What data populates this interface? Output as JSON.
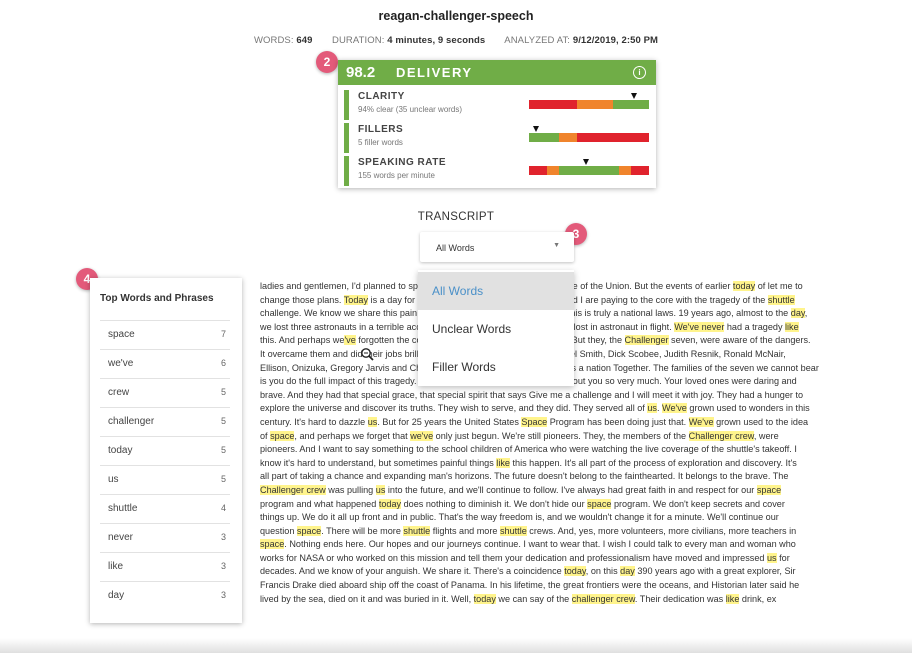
{
  "title": "reagan-challenger-speech",
  "meta": {
    "words_label": "WORDS:",
    "words_value": "649",
    "duration_label": "DURATION:",
    "duration_value": "4 minutes, 9 seconds",
    "analyzed_label": "ANALYZED AT:",
    "analyzed_value": "9/12/2019, 2:50 PM"
  },
  "badges": [
    "2",
    "3",
    "4"
  ],
  "delivery": {
    "score": "98.2",
    "title": "DELIVERY",
    "info_icon": "info-icon",
    "header_color": "#70ad47",
    "metrics": [
      {
        "name": "CLARITY",
        "sub": "94% clear (35 unclear words)",
        "marker_pos": 0.88,
        "segments": [
          {
            "color": "#e0232d",
            "frac": 0.4
          },
          {
            "color": "#f0842c",
            "frac": 0.3
          },
          {
            "color": "#70ad47",
            "frac": 0.3
          }
        ]
      },
      {
        "name": "FILLERS",
        "sub": "5 filler words",
        "marker_pos": 0.06,
        "segments": [
          {
            "color": "#70ad47",
            "frac": 0.25
          },
          {
            "color": "#f0842c",
            "frac": 0.15
          },
          {
            "color": "#e0232d",
            "frac": 0.6
          }
        ]
      },
      {
        "name": "SPEAKING RATE",
        "sub": "155 words per minute",
        "marker_pos": 0.48,
        "segments": [
          {
            "color": "#e0232d",
            "frac": 0.15
          },
          {
            "color": "#f0842c",
            "frac": 0.1
          },
          {
            "color": "#70ad47",
            "frac": 0.5
          },
          {
            "color": "#f0842c",
            "frac": 0.1
          },
          {
            "color": "#e0232d",
            "frac": 0.15
          }
        ]
      }
    ]
  },
  "transcript_label": "TRANSCRIPT",
  "select": {
    "value": "All Words",
    "caret": "▼"
  },
  "dropdown": {
    "options": [
      "All Words",
      "Unclear Words",
      "Filler Words"
    ],
    "active": 0
  },
  "top_words": {
    "title": "Top Words and Phrases",
    "items": [
      {
        "word": "space",
        "count": "7"
      },
      {
        "word": "we've",
        "count": "6"
      },
      {
        "word": "crew",
        "count": "5"
      },
      {
        "word": "challenger",
        "count": "5"
      },
      {
        "word": "today",
        "count": "5"
      },
      {
        "word": "us",
        "count": "5"
      },
      {
        "word": "shuttle",
        "count": "4"
      },
      {
        "word": "never",
        "count": "3"
      },
      {
        "word": "like",
        "count": "3"
      },
      {
        "word": "day",
        "count": "3"
      }
    ]
  },
  "highlight_color": "#fff48c",
  "transcript_lines": [
    [
      [
        "ladies and gentlemen, I'd planned ",
        0
      ],
      [
        "to speak to you tonight to report on the State of the Union. But the events of earlier ",
        2
      ],
      [
        "today",
        1
      ],
      [
        " of let me to",
        0
      ]
    ],
    [
      [
        "change those plans. ",
        0
      ],
      [
        "Today",
        1
      ],
      [
        " is a day for mourning and remembering. Nancy and I are paying to the core with the tragedy of the ",
        0
      ],
      [
        "shuttle",
        1
      ]
    ],
    [
      [
        "challenge. We know we share this pain with all of the people of our country. This is truly a national laws. 19 years ago, almost to the ",
        0
      ],
      [
        "day",
        1
      ],
      [
        ",",
        0
      ]
    ],
    [
      [
        "we lost three astronauts in a terrible accident on the ground. But we ",
        0
      ],
      [
        "'ve never",
        1
      ],
      [
        " lost in astronaut in flight. ",
        0
      ],
      [
        "We've never",
        1
      ],
      [
        " had a tragedy ",
        0
      ],
      [
        "like",
        1
      ]
    ],
    [
      [
        "this. And perhaps we",
        0
      ],
      [
        "'ve",
        1
      ],
      [
        " forgotten the courage it took for the crew of the shot. But they, the ",
        0
      ],
      [
        "Challenger",
        1
      ],
      [
        " seven, were aware of the dangers.",
        0
      ]
    ],
    [
      [
        "It overcame them and did their jobs brilliantly. We mourn seven heroes Michael Smith, Dick Scobee, Judith Resnik, Ronald McNair,",
        0
      ]
    ],
    [
      [
        "Ellison, Onizuka, Gregory Jarvis and Christa McAuliffe. We mourn their loss as a nation Together. The families of the seven we cannot bear",
        0
      ]
    ],
    [
      [
        "is you do the full impact of this tragedy. But we feel the loss. We're thinking about you so very much. Your loved ones were daring and",
        0
      ]
    ],
    [
      [
        "brave. And they had that special grace, that special spirit that says Give me a challenge and I will meet it with joy. They had a hunger to",
        0
      ]
    ],
    [
      [
        "explore the universe and discover its truths. They wish to serve, and they did. They served all of ",
        0
      ],
      [
        "us",
        1
      ],
      [
        ". ",
        0
      ],
      [
        "We've",
        1
      ],
      [
        " grown used to wonders in this",
        0
      ]
    ],
    [
      [
        "century. It's hard to dazzle ",
        0
      ],
      [
        "us",
        1
      ],
      [
        ". But for 25 years the United States ",
        0
      ],
      [
        "Space",
        1
      ],
      [
        " Program has been doing just that. ",
        0
      ],
      [
        "We've",
        1
      ],
      [
        " grown used to the idea",
        0
      ]
    ],
    [
      [
        "of ",
        0
      ],
      [
        "space",
        1
      ],
      [
        ", and perhaps we forget that ",
        0
      ],
      [
        "we've",
        1
      ],
      [
        " only just begun. We're still pioneers. They, the members of the ",
        0
      ],
      [
        "Challenger crew",
        1
      ],
      [
        ", were",
        0
      ]
    ],
    [
      [
        "pioneers. And I want to say something to the school children of America who were watching the live coverage of the shuttle's takeoff. I",
        0
      ]
    ],
    [
      [
        "know it's hard to understand, but sometimes painful things ",
        0
      ],
      [
        "like",
        1
      ],
      [
        " this happen. It's all part of the process of exploration and discovery. It's",
        0
      ]
    ],
    [
      [
        "all part of taking a chance and expanding man's horizons. The future doesn't belong to the fainthearted. It belongs to the brave. The",
        0
      ]
    ],
    [
      [
        "Challenger crew",
        1
      ],
      [
        " was pulling ",
        0
      ],
      [
        "us",
        1
      ],
      [
        " into the future, and we'll continue to follow. I've always had great faith in and respect for our ",
        0
      ],
      [
        "space",
        1
      ]
    ],
    [
      [
        "program and what happened ",
        0
      ],
      [
        "today",
        1
      ],
      [
        " does nothing to diminish it. We don't hide our ",
        0
      ],
      [
        "space",
        1
      ],
      [
        " program. We don't keep secrets and cover",
        0
      ]
    ],
    [
      [
        "things up. We do it all up front and in public. That's the way freedom is, and we wouldn't change it for a minute. We'll continue our",
        0
      ]
    ],
    [
      [
        "question ",
        0
      ],
      [
        "space",
        1
      ],
      [
        ". There will be more ",
        0
      ],
      [
        "shuttle",
        1
      ],
      [
        " flights and more ",
        0
      ],
      [
        "shuttle",
        1
      ],
      [
        " crews. And, yes, more volunteers, more civilians, more teachers in",
        0
      ]
    ],
    [
      [
        "space",
        1
      ],
      [
        ". Nothing ends here. Our hopes and our journeys continue. I want to wear that. I wish I could talk to every man and woman who",
        0
      ]
    ],
    [
      [
        "works for NASA or who worked on this mission and tell them your dedication and professionalism have moved and impressed ",
        0
      ],
      [
        "us",
        1
      ],
      [
        " for",
        0
      ]
    ],
    [
      [
        "decades. And we know of your anguish. We share it. There's a coincidence ",
        0
      ],
      [
        "today",
        1
      ],
      [
        ", on this ",
        0
      ],
      [
        "day",
        1
      ],
      [
        " 390 years ago with a great explorer, Sir",
        0
      ]
    ],
    [
      [
        "Francis Drake died aboard ship off the coast of Panama. In his lifetime, the great frontiers were the oceans, and Historian later said he",
        0
      ]
    ],
    [
      [
        "lived by the sea, died on it and was buried in it. Well, ",
        0
      ],
      [
        "today",
        1
      ],
      [
        " we can say of the ",
        0
      ],
      [
        "challenger crew",
        1
      ],
      [
        ". Their dedication was ",
        0
      ],
      [
        "like",
        1
      ],
      [
        " drink, ex",
        0
      ]
    ]
  ]
}
